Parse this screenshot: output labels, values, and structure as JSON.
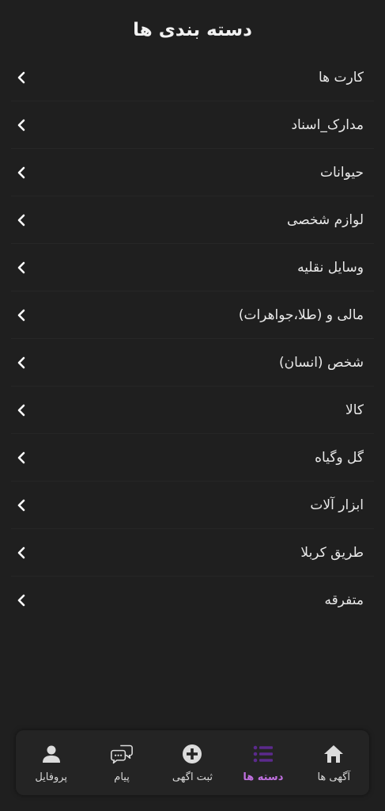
{
  "header": {
    "title": "دسته بندی ها"
  },
  "categories": [
    {
      "label": "کارت ها"
    },
    {
      "label": "مدارک_اسناد"
    },
    {
      "label": "حیوانات"
    },
    {
      "label": "لوازم شخصی"
    },
    {
      "label": "وسایل نقلیه"
    },
    {
      "label": "مالی و (طلا،جواهرات)"
    },
    {
      "label": "شخص (انسان)"
    },
    {
      "label": "کالا"
    },
    {
      "label": "گل وگیاه"
    },
    {
      "label": "ابزار آلات"
    },
    {
      "label": "طریق کربلا"
    },
    {
      "label": "متفرقه"
    }
  ],
  "bottom_nav": {
    "items": [
      {
        "label": "آگهی ها",
        "icon": "home-icon"
      },
      {
        "label": "دسته ها",
        "icon": "list-icon",
        "active": true
      },
      {
        "label": "ثبت اگهی",
        "icon": "add-circle-icon"
      },
      {
        "label": "پیام",
        "icon": "chat-icon"
      },
      {
        "label": "پروفایل",
        "icon": "person-icon"
      }
    ],
    "active_color": "#c070e0",
    "icon_color": "#d9d9d9",
    "active_icon_color": "#5b2a8c"
  }
}
